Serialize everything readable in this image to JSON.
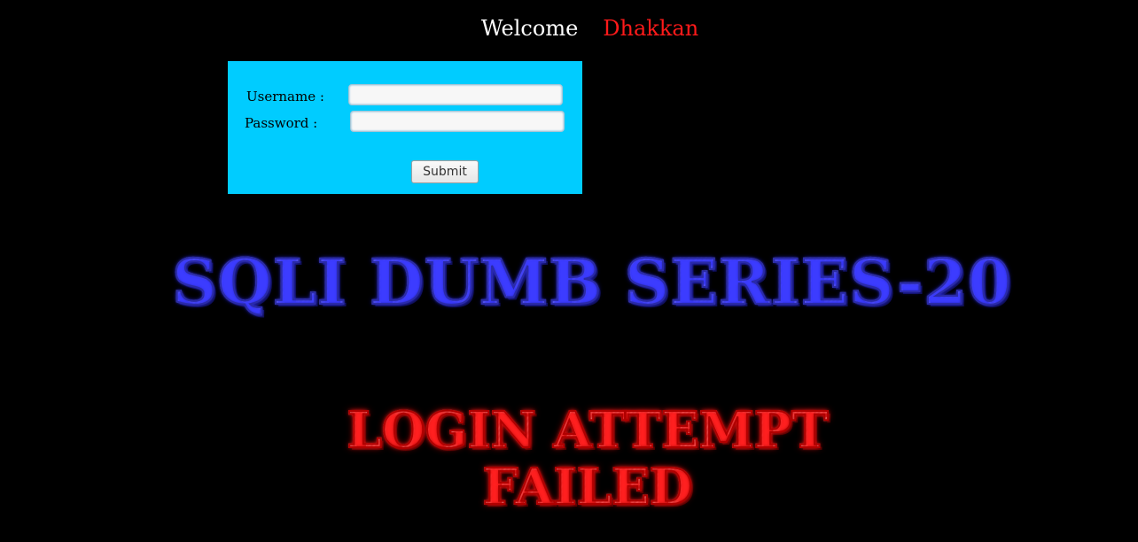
{
  "header": {
    "welcome_text": "Welcome",
    "user_name": "Dhakkan"
  },
  "login_form": {
    "username_label": "Username :",
    "password_label": "Password :",
    "username_value": "",
    "password_value": "",
    "submit_label": "Submit"
  },
  "banner": {
    "title": "SQLI DUMB SERIES-20",
    "status_message": "LOGIN ATTEMPT FAILED"
  },
  "colors": {
    "background": "#000000",
    "form_background": "#00ccff",
    "user_name": "#ff1a1a",
    "title_glow": "#2a2aa8",
    "failed_glow": "#d00000"
  }
}
